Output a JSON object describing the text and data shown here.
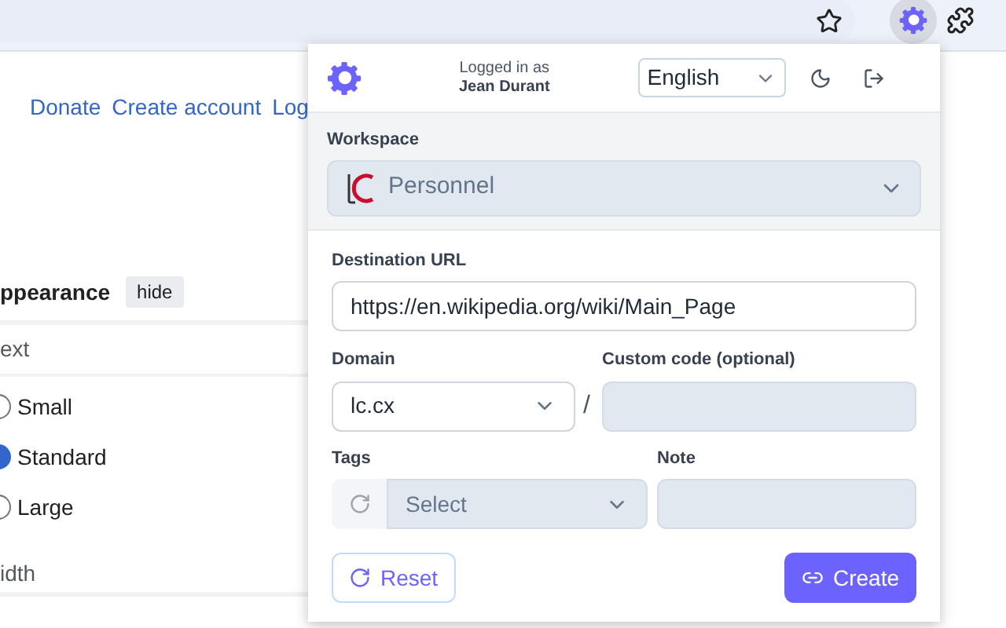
{
  "page": {
    "links": [
      "Donate",
      "Create account",
      "Log"
    ],
    "appearance": {
      "title": "ppearance",
      "hide_button": "hide",
      "text_heading": "ext",
      "text_options": [
        {
          "label": "Small",
          "selected": false
        },
        {
          "label": "Standard",
          "selected": true
        },
        {
          "label": "Large",
          "selected": false
        }
      ],
      "width_heading": "idth"
    }
  },
  "popup": {
    "logged_in_label": "Logged in as",
    "user": "Jean Durant",
    "language": "English",
    "workspace": {
      "label": "Workspace",
      "value": "Personnel",
      "disabled": true
    },
    "destination": {
      "label": "Destination URL",
      "value": "https://en.wikipedia.org/wiki/Main_Page"
    },
    "domain": {
      "label": "Domain",
      "value": "lc.cx"
    },
    "separator": "/",
    "custom_code": {
      "label": "Custom code (optional)",
      "disabled": true
    },
    "tags": {
      "label": "Tags",
      "placeholder": "Select",
      "disabled": true
    },
    "note": {
      "label": "Note",
      "disabled": true
    },
    "buttons": [
      {
        "label": "Reset",
        "kind": "secondary"
      },
      {
        "label": "Create",
        "kind": "primary"
      }
    ]
  }
}
